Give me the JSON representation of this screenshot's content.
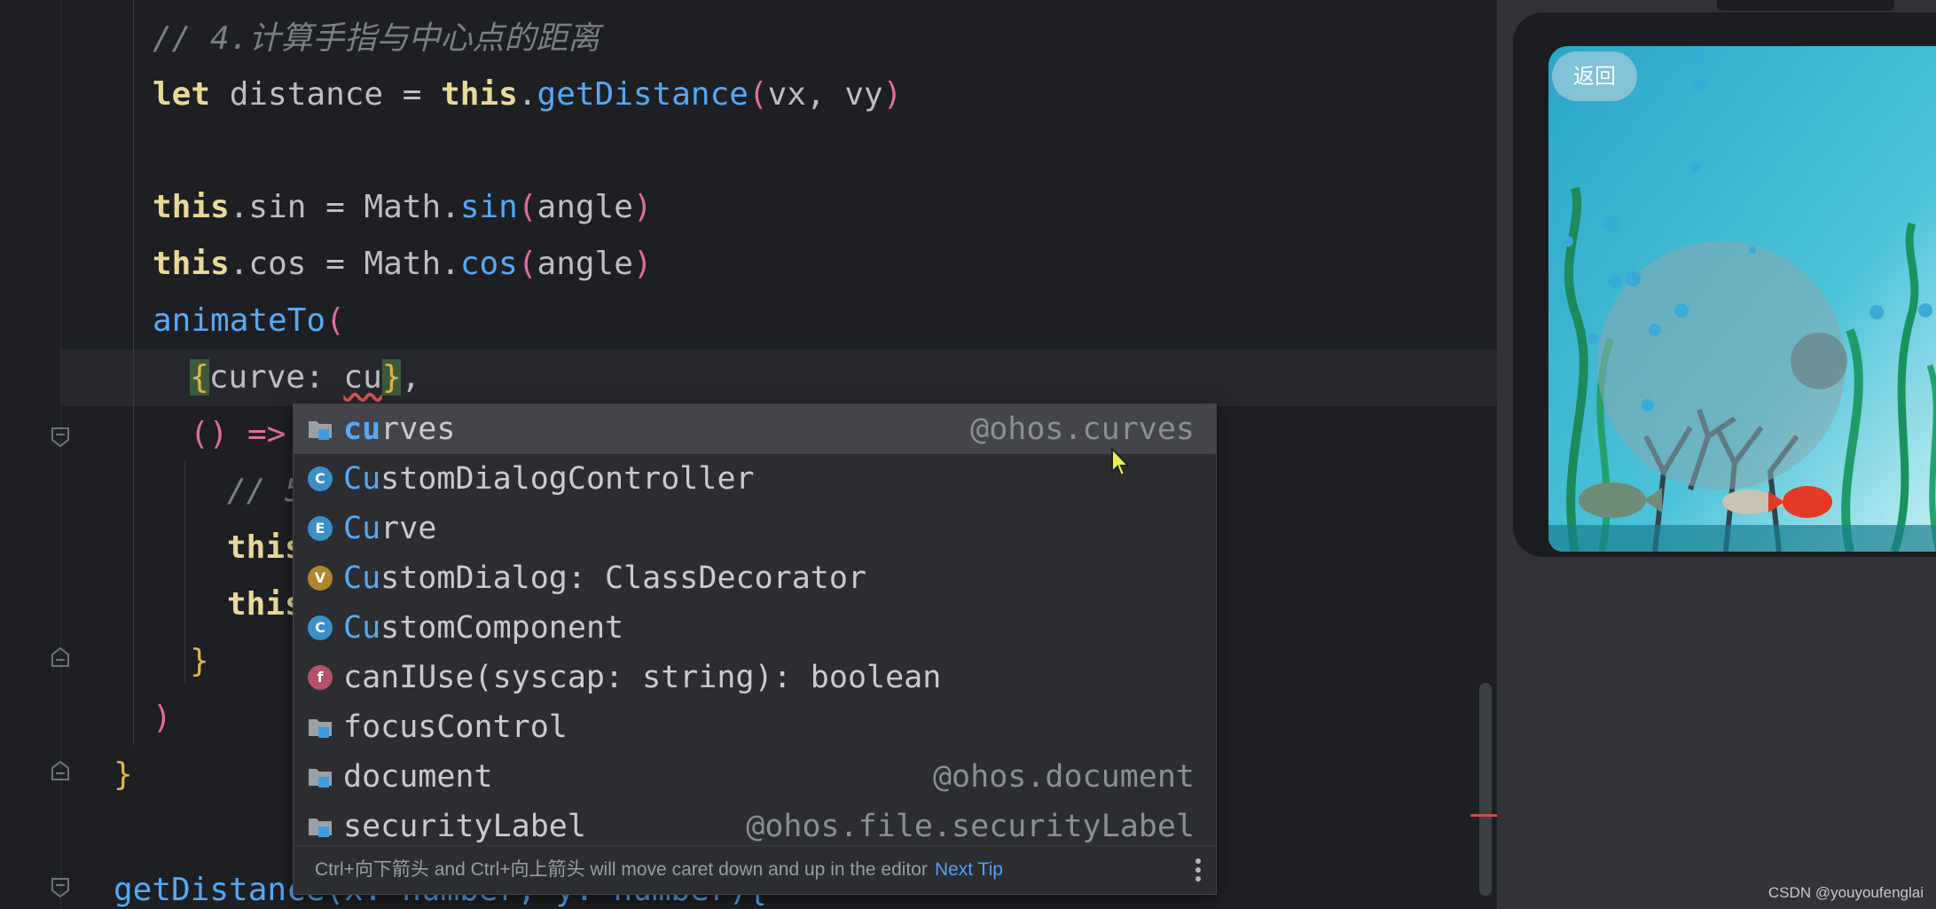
{
  "editor": {
    "lines": {
      "comment4": "// 4.计算手指与中心点的距离",
      "let_kw": "let",
      "distance_decl": " distance = ",
      "this": "this",
      "dot": ".",
      "getDistance": "getDistance",
      "open": "(",
      "args_vx_vy": "vx, vy",
      "close": ")",
      "sin_prop": "sin",
      "eq_math": " = Math.",
      "angle": "angle",
      "cos_prop": "cos",
      "animateTo": "animateTo",
      "brace_open": "{",
      "curve_key": "curve: ",
      "cu_typed": "cu",
      "brace_close_comma": "},",
      "arrow": "() =>",
      "comment5_partial": "// 5",
      "this_partial": "this",
      "block_close": "}",
      "paren_close": ")",
      "fn_close": "}",
      "getDistance_sig": "getDistance(x: number, y: number){"
    }
  },
  "autocomplete": {
    "items": [
      {
        "icon": "folder-package-icon",
        "prefix": "cu",
        "rest": "rves",
        "type": "@ohos.curves",
        "selected": true
      },
      {
        "icon": "class-icon",
        "badge": "C",
        "prefix": "Cu",
        "rest": "stomDialogController",
        "type": ""
      },
      {
        "icon": "enum-icon",
        "badge": "E",
        "prefix": "Cu",
        "rest": "rve",
        "type": ""
      },
      {
        "icon": "variable-icon",
        "badge": "V",
        "prefix": "Cu",
        "rest": "stomDialog: ClassDecorator",
        "type": ""
      },
      {
        "icon": "class-icon",
        "badge": "C",
        "prefix": "Cu",
        "rest": "stomComponent",
        "type": ""
      },
      {
        "icon": "function-icon",
        "badge": "f",
        "label": "canIUse(syscap: string): boolean",
        "type": ""
      },
      {
        "icon": "folder-package-icon",
        "label": "focusControl",
        "type": ""
      },
      {
        "icon": "folder-package-icon",
        "label": "document",
        "type": "@ohos.document"
      },
      {
        "icon": "folder-package-icon",
        "label": "securityLabel",
        "type": "@ohos.file.securityLabel"
      }
    ],
    "footer": {
      "tip": "Ctrl+向下箭头 and Ctrl+向上箭头 will move caret down and up in the editor",
      "next_tip": "Next Tip"
    },
    "colors": {
      "class": "#3a8fc9",
      "enum": "#3a8fc9",
      "variable": "#b0852e",
      "function": "#b4506b"
    }
  },
  "preview": {
    "back_label": "返回"
  },
  "watermark": "CSDN @youyoufenglai"
}
